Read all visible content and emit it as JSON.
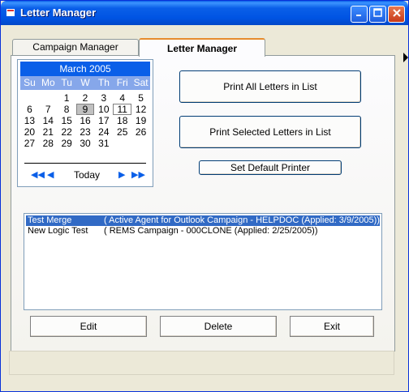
{
  "window": {
    "title": "Letter Manager"
  },
  "tabs": [
    {
      "label": "Campaign Manager"
    },
    {
      "label": "Letter Manager"
    }
  ],
  "calendar": {
    "month_title": "March 2005",
    "days_of_week": [
      "Su",
      "Mo",
      "Tu",
      "W",
      "Th",
      "Fri",
      "Sat"
    ],
    "weeks": [
      [
        "",
        "",
        "1",
        "2",
        "3",
        "4",
        "5"
      ],
      [
        "6",
        "7",
        "8",
        "9",
        "10",
        "11",
        "12"
      ],
      [
        "13",
        "14",
        "15",
        "16",
        "17",
        "18",
        "19"
      ],
      [
        "20",
        "21",
        "22",
        "23",
        "24",
        "25",
        "26"
      ],
      [
        "27",
        "28",
        "29",
        "30",
        "31",
        "",
        ""
      ]
    ],
    "selected_day": "9",
    "today_day": "11",
    "today_label": "Today"
  },
  "actions": {
    "print_all": "Print All Letters in List",
    "print_selected": "Print Selected Letters in List",
    "set_default_printer": "Set Default Printer"
  },
  "letters": [
    {
      "name": "Test Merge",
      "detail": "( Active Agent for Outlook Campaign - HELPDOC (Applied: 3/9/2005))",
      "selected": true
    },
    {
      "name": "New Logic Test",
      "detail": "( REMS Campaign - 000CLONE (Applied: 2/25/2005))",
      "selected": false
    }
  ],
  "bottom_buttons": {
    "edit": "Edit",
    "delete": "Delete",
    "exit": "Exit"
  },
  "icons": {
    "app": "app-icon",
    "minimize": "minimize-icon",
    "maximize": "maximize-icon",
    "close": "close-icon"
  }
}
